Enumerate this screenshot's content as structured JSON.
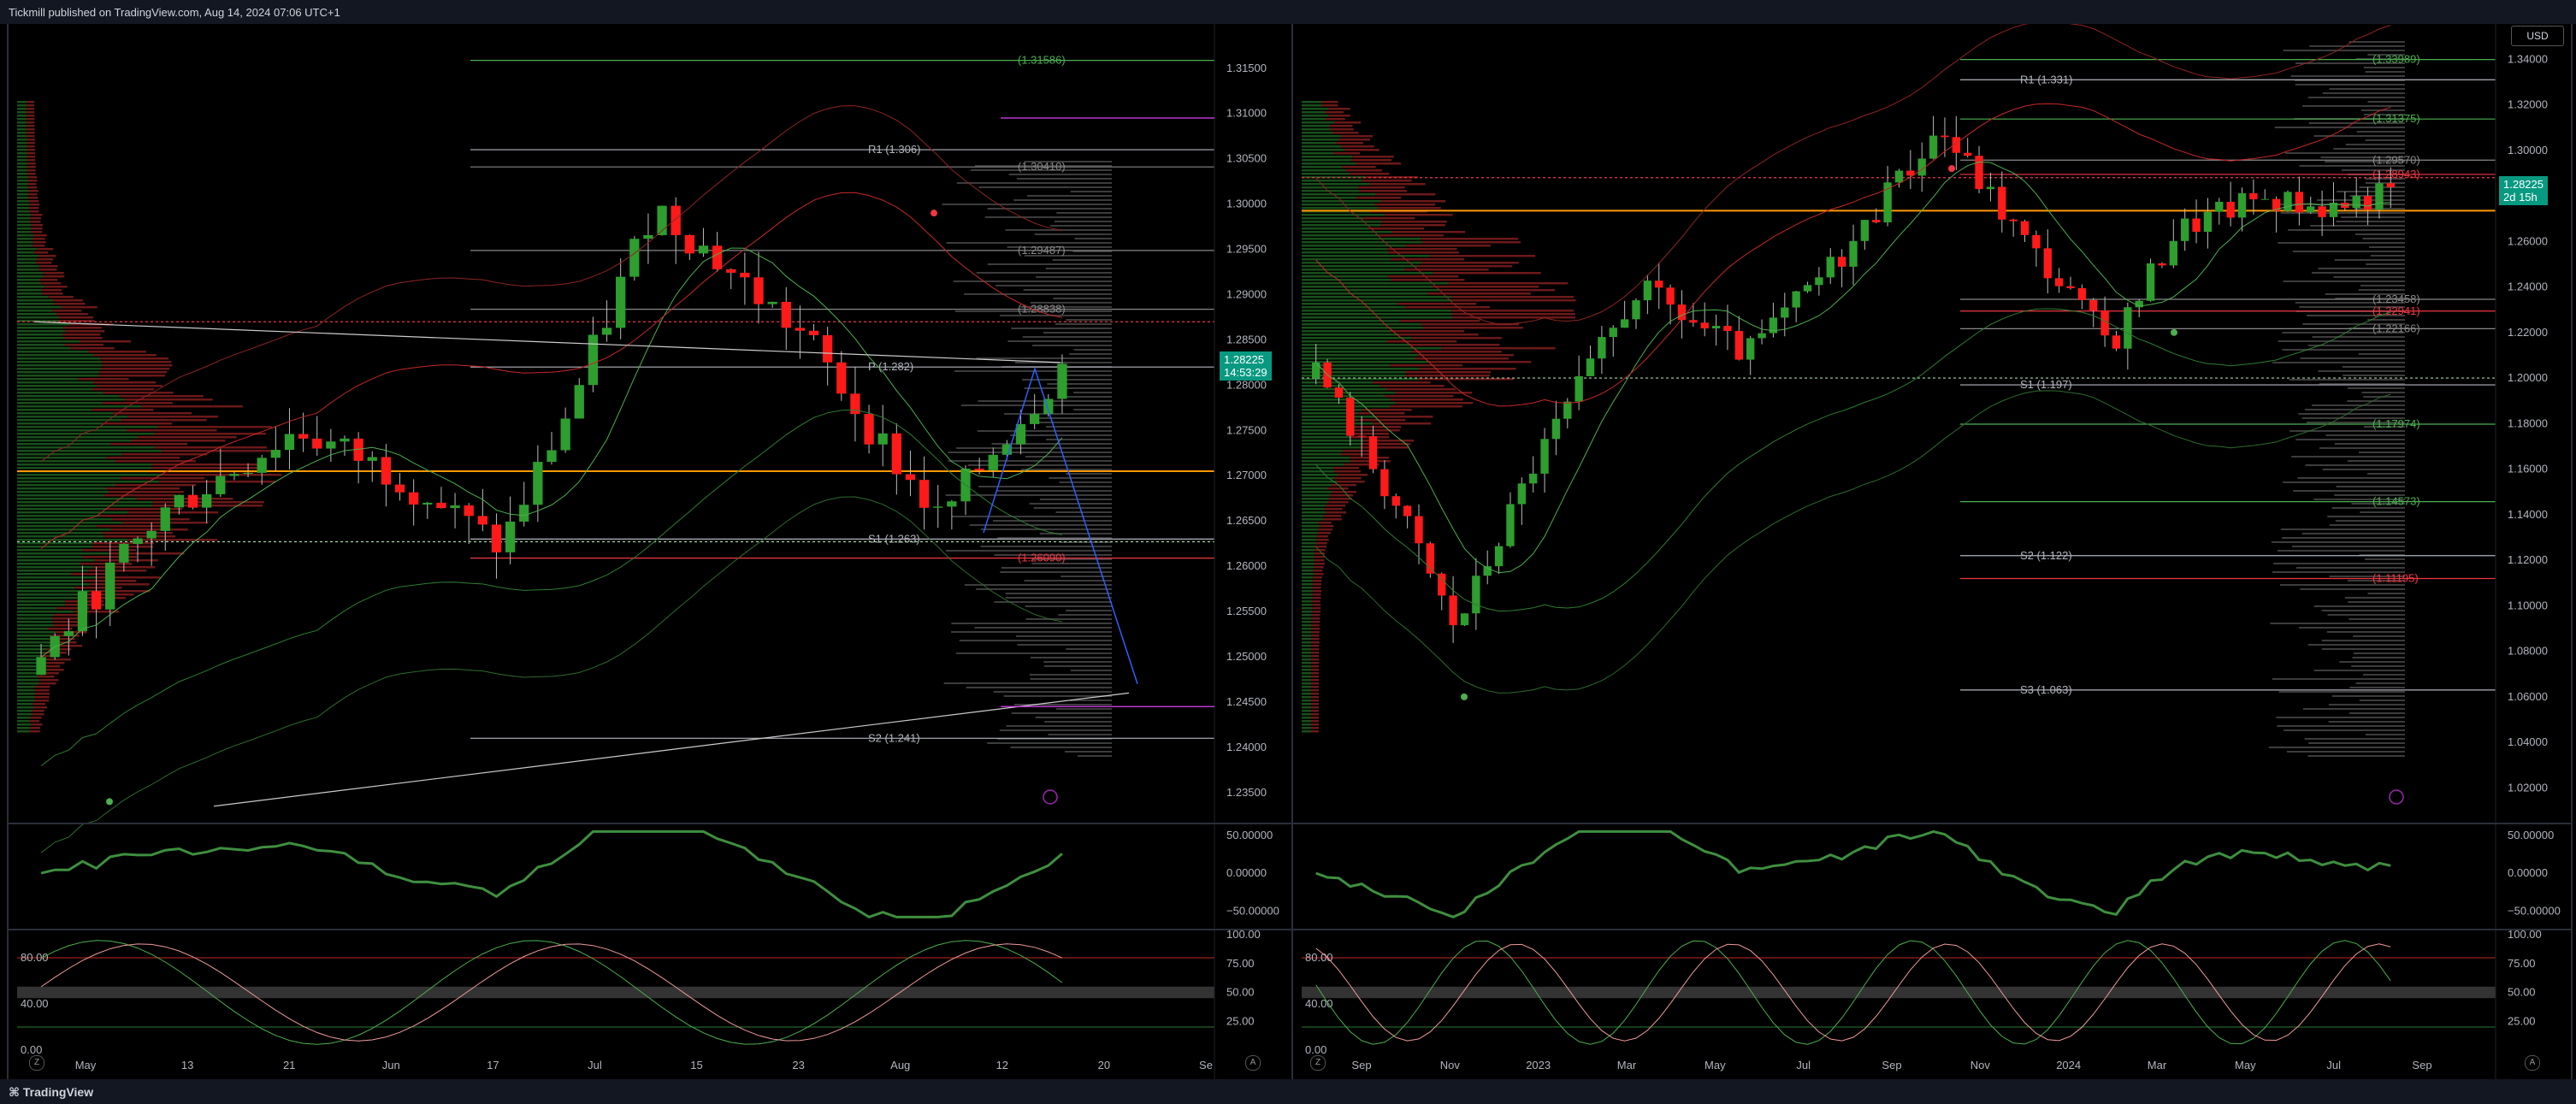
{
  "header": {
    "published": "Tickmill published on TradingView.com, Aug 14, 2024 07:06 UTC+1"
  },
  "footer": {
    "brand": "TradingView"
  },
  "left": {
    "price_ticks": [
      "1.31500",
      "1.31000",
      "1.30500",
      "1.30000",
      "1.29500",
      "1.29000",
      "1.28500",
      "1.28000",
      "1.27500",
      "1.27000",
      "1.26500",
      "1.26000",
      "1.25500",
      "1.25000",
      "1.24500",
      "1.24000",
      "1.23500"
    ],
    "time_ticks": [
      "May",
      "13",
      "21",
      "Jun",
      "17",
      "Jul",
      "15",
      "23",
      "Aug",
      "12",
      "20",
      "Se"
    ],
    "osc_ticks": [
      "50.00000",
      "0.00000",
      "−50.00000"
    ],
    "stoch_ticks_left": [
      "80.00",
      "40.00",
      "0.00"
    ],
    "stoch_ticks_right": [
      "100.00",
      "75.00",
      "50.00",
      "25.00"
    ],
    "last_price": "1.28225",
    "countdown": "14:53:29",
    "levels": [
      {
        "label": "(1.31586)",
        "price": 1.31586,
        "color": "#4caf50"
      },
      {
        "label": "R1 (1.306)",
        "price": 1.306,
        "color": "#b2b5be"
      },
      {
        "label": "(1.30410)",
        "price": 1.3041,
        "color": "#888"
      },
      {
        "label": "(1.29487)",
        "price": 1.29487,
        "color": "#888"
      },
      {
        "label": "(1.28838)",
        "price": 1.28838,
        "color": "#888"
      },
      {
        "label": "P (1.282)",
        "price": 1.282,
        "color": "#b2b5be"
      },
      {
        "label": "S1 (1.263)",
        "price": 1.263,
        "color": "#b2b5be"
      },
      {
        "label": "(1.26090)",
        "price": 1.2609,
        "color": "#f23645"
      },
      {
        "label": "S2 (1.241)",
        "price": 1.241,
        "color": "#b2b5be"
      }
    ]
  },
  "right": {
    "currency": "USD",
    "price_ticks": [
      "1.34000",
      "1.32000",
      "1.30000",
      "1.28000",
      "1.26000",
      "1.24000",
      "1.22000",
      "1.20000",
      "1.18000",
      "1.16000",
      "1.14000",
      "1.12000",
      "1.10000",
      "1.08000",
      "1.06000",
      "1.04000",
      "1.02000"
    ],
    "time_ticks": [
      "Sep",
      "Nov",
      "2023",
      "Mar",
      "May",
      "Jul",
      "Sep",
      "Nov",
      "2024",
      "Mar",
      "May",
      "Jul",
      "Sep"
    ],
    "osc_ticks": [
      "50.00000",
      "0.00000",
      "−50.00000"
    ],
    "stoch_ticks_left": [
      "80.00",
      "40.00",
      "0.00"
    ],
    "stoch_ticks_right": [
      "100.00",
      "75.00",
      "50.00",
      "25.00"
    ],
    "last_price": "1.28225",
    "countdown": "2d 15h",
    "levels": [
      {
        "label": "(1.33989)",
        "price": 1.33989,
        "color": "#4caf50"
      },
      {
        "label": "R1 (1.331)",
        "price": 1.331,
        "color": "#b2b5be"
      },
      {
        "label": "(1.31375)",
        "price": 1.31375,
        "color": "#4caf50"
      },
      {
        "label": "(1.29570)",
        "price": 1.2957,
        "color": "#888"
      },
      {
        "label": "(1.28943)",
        "price": 1.28943,
        "color": "#f23645"
      },
      {
        "label": "(1.23458)",
        "price": 1.23458,
        "color": "#888"
      },
      {
        "label": "(1.22941)",
        "price": 1.22941,
        "color": "#f23645"
      },
      {
        "label": "(1.22166)",
        "price": 1.22166,
        "color": "#888"
      },
      {
        "label": "S1 (1.197)",
        "price": 1.197,
        "color": "#b2b5be"
      },
      {
        "label": "(1.17974)",
        "price": 1.17974,
        "color": "#4caf50"
      },
      {
        "label": "(1.14573)",
        "price": 1.14573,
        "color": "#4caf50"
      },
      {
        "label": "S2 (1.122)",
        "price": 1.122,
        "color": "#b2b5be"
      },
      {
        "label": "(1.11195)",
        "price": 1.11195,
        "color": "#f23645"
      },
      {
        "label": "S3 (1.063)",
        "price": 1.063,
        "color": "#b2b5be"
      }
    ]
  },
  "colors": {
    "up": "#089981",
    "down": "#f23645",
    "green": "#4caf50",
    "red": "#f23645",
    "orange": "#ff9800",
    "blue": "#2962ff",
    "bg": "#000000"
  }
}
